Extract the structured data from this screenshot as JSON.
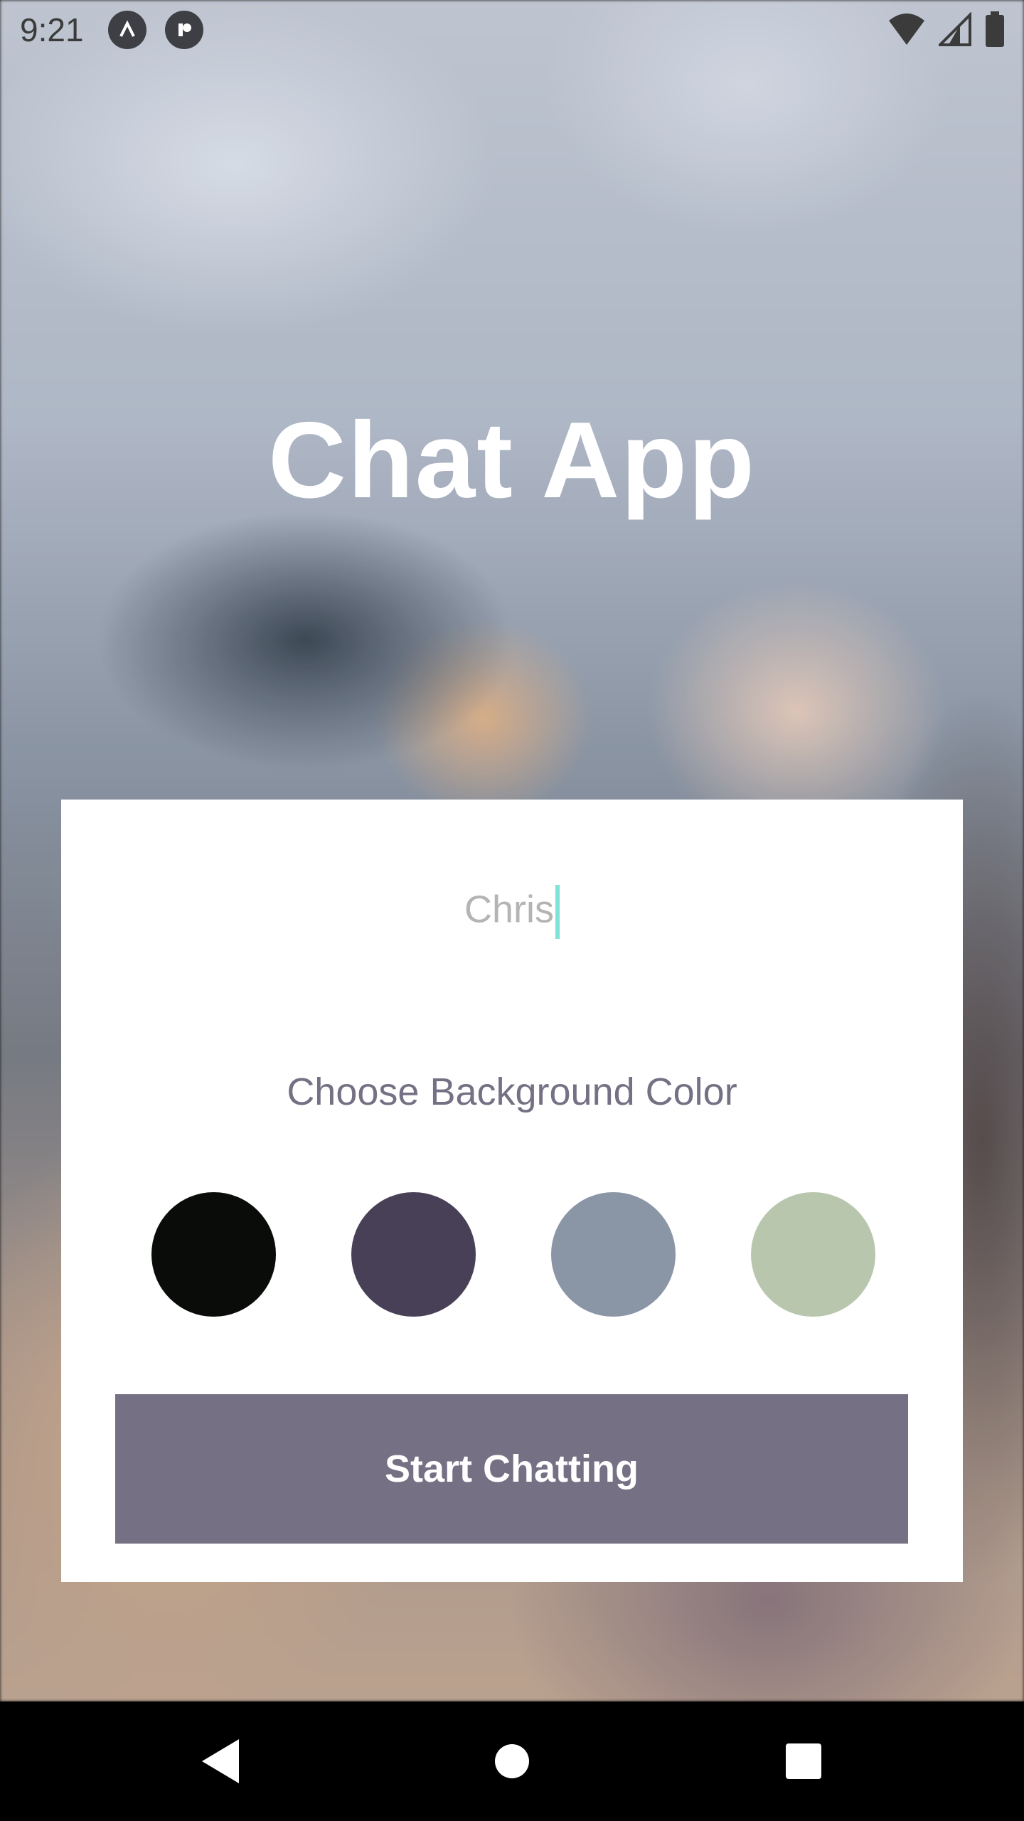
{
  "status_bar": {
    "time": "9:21",
    "app_icons": [
      "a-app-icon",
      "r-app-icon"
    ]
  },
  "title": "Chat App",
  "form": {
    "name_value": "Chris",
    "choose_label": "Choose Background Color",
    "colors": [
      "#090C08",
      "#474056",
      "#8A95A5",
      "#B9C6AE"
    ],
    "start_label": "Start Chatting",
    "button_color": "#757083"
  },
  "nav": {
    "icons": [
      "back-icon",
      "home-icon",
      "recents-icon"
    ]
  }
}
